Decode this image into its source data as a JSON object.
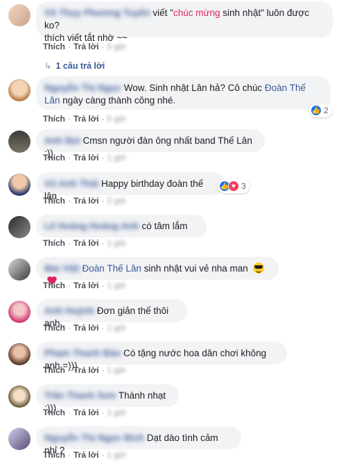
{
  "actions": {
    "like": "Thích",
    "reply": "Trả lời",
    "sep": "·"
  },
  "comments": [
    {
      "author": "Võ Thụy Phương Tuyền",
      "text_before": "viết \"",
      "text_red": "chúc mừng",
      "text_after": " sinh nhật\" luôn được ko?",
      "text_line2": "thích viết tắt nhờ ~~",
      "time": "5 giờ"
    },
    {
      "author": "Nguyễn Thị Ngọc",
      "text": "Wow. Sinh nhật Lân hả? Cô chúc",
      "mention": "Đoàn Thế Lân",
      "text_after": "ngày càng thành công nhé.",
      "time": "5 giờ",
      "reaction_count": "2"
    },
    {
      "author": "Anh Bùi",
      "text": "Cmsn người đàn ông nhất band Thế Lân :))",
      "time": "1 giờ"
    },
    {
      "author": "Vũ Anh Thái",
      "text": "Happy birthday đoàn thế lân",
      "time": "2 giờ",
      "reaction_count": "3"
    },
    {
      "author": "Lê Hoàng Hoàng Anh",
      "text": "có tâm lắm",
      "time": "1 giờ"
    },
    {
      "author": "Mai Việt",
      "mention": "Đoàn Thế Lân",
      "text": "sinh nhật vui vẻ nha man",
      "time": "1 giờ"
    },
    {
      "author": "Anh Huỳnh",
      "text": "Đơn giản thế thôi anh..",
      "time": "1 giờ"
    },
    {
      "author": "Phạm Thanh Bảo",
      "text": "Có tặng nước hoa dân chơi không anh =)))",
      "time": "1 giờ"
    },
    {
      "author": "Trần Thanh Sơn",
      "text": "Thánh nhạt :)))",
      "time": "1 giờ"
    },
    {
      "author": "Nguyễn Thị Ngọc Bích",
      "text": "Dạt dào tình cảm nhỉ ?",
      "time": "1 giờ"
    }
  ],
  "replies_link": "1 câu trả lời",
  "colors": {
    "link": "#385898",
    "bubble": "#f2f3f5",
    "like": "#1877f2",
    "love": "#f33e58"
  },
  "icons": [
    "like-reaction-icon",
    "love-reaction-icon",
    "reply-arrow-icon",
    "sunglasses-emoji-icon",
    "heart-emoji-icon"
  ]
}
